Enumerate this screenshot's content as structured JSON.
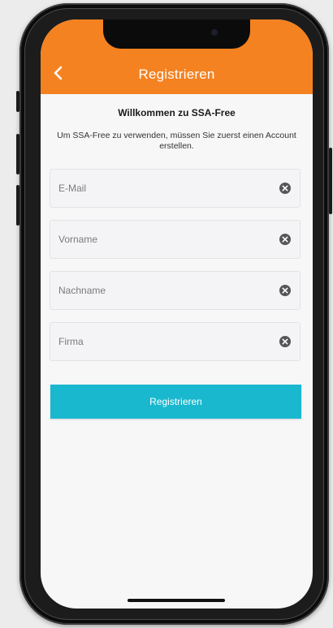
{
  "header": {
    "title": "Registrieren",
    "back_icon": "chevron-left-icon",
    "color": "#f58220"
  },
  "welcome": {
    "title": "Willkommen zu SSA-Free",
    "subtitle": "Um SSA-Free zu verwenden, müssen Sie zuerst einen Account erstellen."
  },
  "form": {
    "fields": [
      {
        "placeholder": "E-Mail",
        "value": "",
        "clear_icon": "clear-circle-icon"
      },
      {
        "placeholder": "Vorname",
        "value": "",
        "clear_icon": "clear-circle-icon"
      },
      {
        "placeholder": "Nachname",
        "value": "",
        "clear_icon": "clear-circle-icon"
      },
      {
        "placeholder": "Firma",
        "value": "",
        "clear_icon": "clear-circle-icon"
      }
    ],
    "submit_label": "Registrieren",
    "submit_color": "#1ab8cf"
  }
}
